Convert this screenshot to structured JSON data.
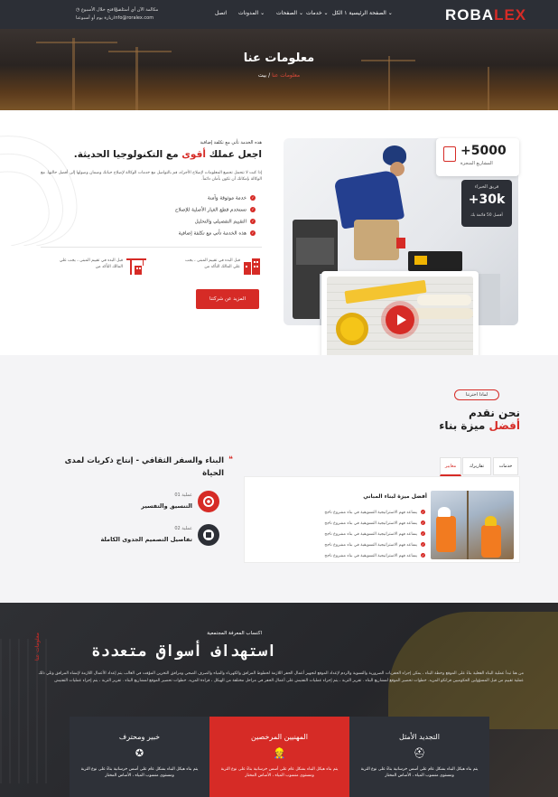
{
  "header": {
    "logo": {
      "main": "ROBA",
      "accent": "LEX"
    },
    "nav": [
      {
        "label": "الصفحة الرئيسية ١ الكل"
      },
      {
        "label": "خدمات"
      },
      {
        "label": "الصفحات"
      },
      {
        "label": "المدونات"
      },
      {
        "label": "اتصل"
      }
    ],
    "contact": {
      "email": "info@roralex.com",
      "phone_caption": "مكالمة الآن أي أسئلة",
      "hours": "من فتح خلال الأسبوع",
      "hours_sub": "زيارة يوم أو أسبوعنا"
    }
  },
  "hero": {
    "title": "معلومات عنا",
    "breadcrumb_current": "معلومات عنا",
    "breadcrumb_sep": "/",
    "breadcrumb_home": "بيت"
  },
  "about": {
    "kicker": "هذه الخدمة تأتي مع تكلفة إضافية",
    "title_before": "اجعل عملك ",
    "title_accent": "أقوى",
    "title_after": " مع التكنولوجيا الحديثة.",
    "paragraph": "إذا كنت لا تتحمل تجميع المعلومات لإصلاح الأجزاء، قم بالتواصل مع خدمات الوكالة لإصلاح حياتك وضمان وصولها إلى أفضل حالتها. مع الوكالة بإمكانك أن تكون بأمان دائماً.",
    "checklist": [
      "خدمة موثوقة وآمنة",
      "تستخدم قطع الغيار الأصلية للإصلاح",
      "التقييم التفصيلي والتحليل",
      "هذه الخدمة تأتي مع تكلفة إضافية"
    ],
    "features": [
      {
        "text": "قبل البدء في تقييم المبنى ، يجب علي المالك التأكد من",
        "icon": "building-icon"
      },
      {
        "text": "قبل البدء في تقييم المبنى ، يجب علي المالك التأكد من",
        "icon": "crane-icon"
      }
    ],
    "cta": "المزيد عن شركتنا",
    "stats": [
      {
        "value": "5000+",
        "label": "المشاريع المنجزة"
      },
      {
        "value": "30k+",
        "label_top": "فريق الخبراء",
        "label_bottom": "أفضل 50 قائمة بك"
      }
    ]
  },
  "why": {
    "kicker": "لماذا اخترتنا",
    "title_line1": "نحن نقدم",
    "title_accent": "أفضل",
    "title_line2": " ميزة بناء",
    "tabs": [
      "خدمات",
      "تقاريرك",
      "معايير"
    ],
    "panel_title": "أفضل ميزة لبناء المباني",
    "panel_items": [
      "يساعد فهم الاستراتيجية التسويقية في بناء مشروع ناجح",
      "يساعد فهم الاستراتيجية التسويقية في بناء مشروع ناجح",
      "يساعد فهم الاستراتيجية التسويقية في بناء مشروع ناجح",
      "يساعد فهم الاستراتيجية التسويقية في بناء مشروع ناجح",
      "يساعد فهم الاستراتيجية التسويقية في بناء مشروع ناجح"
    ],
    "side_title": "البناء والسفر الثقافي - إنتاج ذكريات لمدى الحياة",
    "steps": [
      {
        "num": "عملية 01",
        "title": "التنسيق والتفسير"
      },
      {
        "num": "عملية 02",
        "title": "تفاصيل التصميم الجدوى الكاملة"
      }
    ]
  },
  "markets": {
    "vertical": "معلومات عنا",
    "kicker": "اكتساب المعرفة المجتمعية",
    "title": "استهداف أسواق متعددة",
    "paragraph": "من هنا تبدأ عملية البناء الفعلية بناءً على الموقع وخطة البناء ، يمكن إجراء الحفريات الضرورية والتسوية والردم لإعداد الموقع لتجهيز أعمال الحفر اللازمة لخطوط المرافق والكهرباء والمياه والصرف الصحي ومرافق التخزين المؤقت في الغالب يتم إعداد الأعمال اللازمة لإنشاء المرافق وتلي ذلك عملية تقييم من قبل المسؤولين الحكوميين فرانكو المزيد. خطوات تحضير الموقع لمشاريع البناء . تقرير التربة ، يتم إجراء عمليات التفتيش على أعمال الحفر في مراحل مختلفة من الهيكل ، قراءة المزيد. خطوات تحضير الموقع لمشاريع البناء . تقرير التربة ، يتم إجراء عمليات التفتيش",
    "cards": [
      {
        "title": "التجديد الأمثل",
        "text": "يتم بناء هيكل البناء بشكل عام على أسس خرسانية بناءً على نوع التربة ومستوى منسوب المياه ، الأساس المختار",
        "icon": "helmet-icon"
      },
      {
        "title": "المهنيين المرخصين",
        "text": "يتم بناء هيكل البناء بشكل عام على أسس خرسانية بناءً على نوع التربة ومستوى منسوب المياه ، الأساس المختار",
        "icon": "engineer-icon"
      },
      {
        "title": "خبير ومحترف",
        "text": "يتم بناء هيكل البناء بشكل عام على أسس خرسانية بناءً على نوع التربة ومستوى منسوب المياه ، الأساس المختار",
        "icon": "award-icon"
      }
    ]
  },
  "colors": {
    "accent": "#d62b26",
    "dark": "#2c2f36"
  }
}
